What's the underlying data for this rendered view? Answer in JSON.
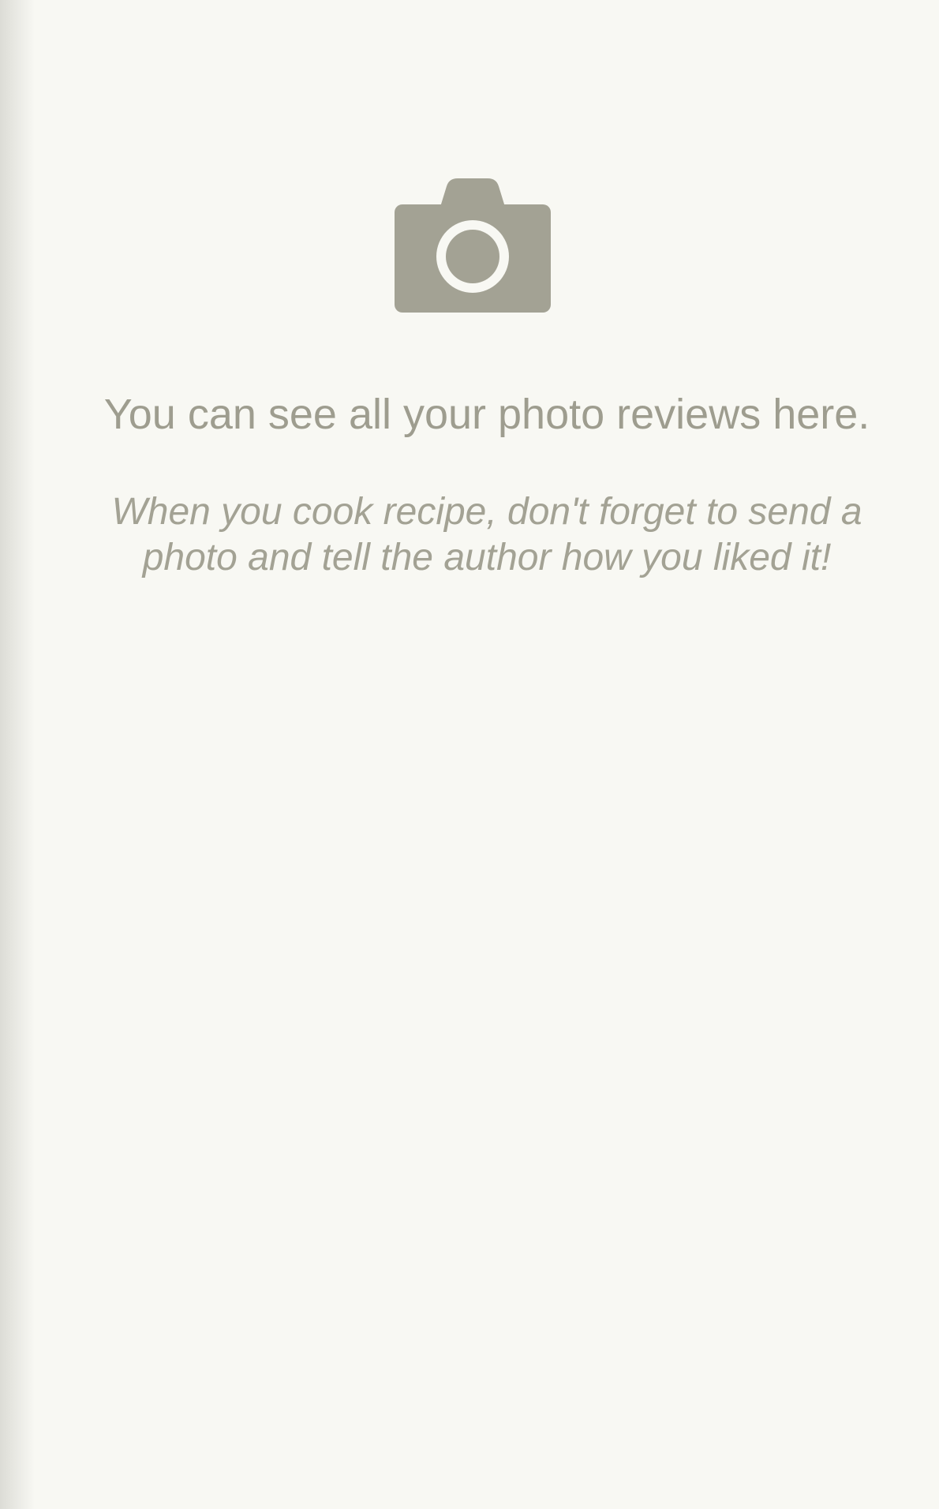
{
  "empty_state": {
    "icon": "camera-icon",
    "title": "You can see all your photo reviews here.",
    "subtitle": "When you cook recipe, don't forget to send a photo and tell the author how you liked it!"
  },
  "colors": {
    "background": "#f8f8f3",
    "icon": "#a3a294",
    "text": "#9e9d8f"
  }
}
